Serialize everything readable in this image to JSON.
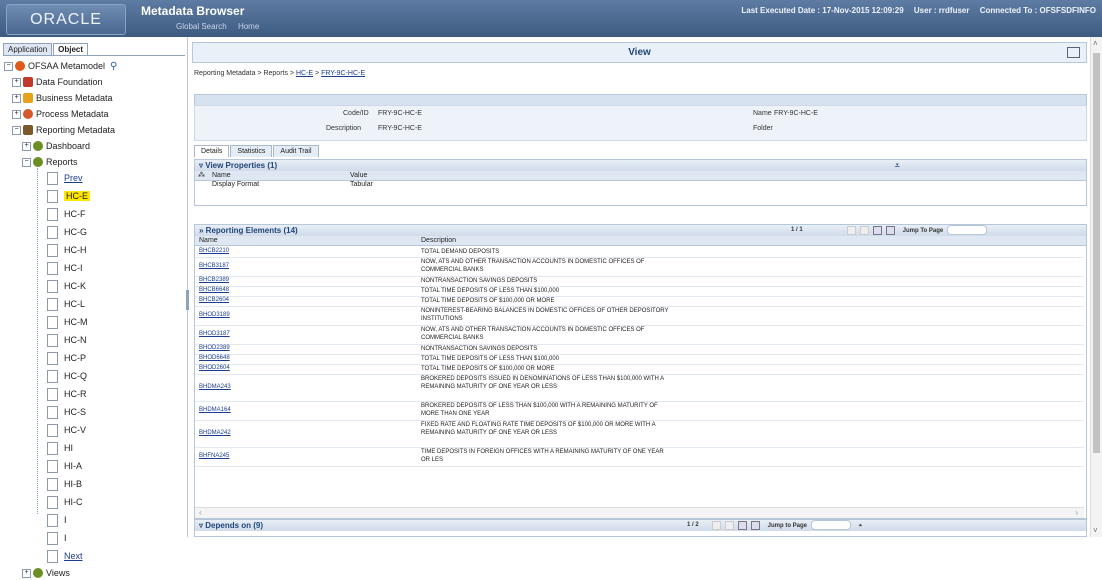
{
  "header": {
    "logo": "ORACLE",
    "title": "Metadata Browser",
    "nav": [
      "Global Search",
      "Home"
    ],
    "last_executed": "Last Executed Date : 17-Nov-2015 12:09:29",
    "user": "User : rrdfuser",
    "connected": "Connected To : OFSFSDFINFO"
  },
  "left": {
    "tabs": [
      "Application",
      "Object"
    ],
    "root": "OFSAA Metamodel",
    "groups": [
      "Data Foundation",
      "Business Metadata",
      "Process Metadata",
      "Reporting Metadata"
    ],
    "reporting_children": [
      "Dashboard",
      "Reports"
    ],
    "reports": [
      "Prev",
      "HC-E",
      "HC-F",
      "HC-G",
      "HC-H",
      "HC-I",
      "HC-K",
      "HC-L",
      "HC-M",
      "HC-N",
      "HC-P",
      "HC-Q",
      "HC-R",
      "HC-S",
      "HC-V",
      "HI",
      "HI-A",
      "HI-B",
      "HI-C",
      "I",
      "I",
      "Next"
    ],
    "views": "Views"
  },
  "main": {
    "view_title": "View",
    "breadcrumb": {
      "prefix": "Reporting Metadata > Reports > ",
      "link1": "HC-E",
      "sep": " > ",
      "link2": "FRY-9C-HC-E"
    },
    "code_label": "Code/ID",
    "code_value": "FRY-9C-HC-E",
    "desc_label": "Description",
    "desc_value": "FRY-9C-HC-E",
    "name_label": "Name",
    "name_value": "FRY-9C-HC-E",
    "folder_label": "Folder",
    "tabs": [
      "Details",
      "Statistics",
      "Audit Trail"
    ],
    "view_props": {
      "title": "View Properties (1)",
      "col_name": "Name",
      "col_value": "Value",
      "row_name": "Display Format",
      "row_value": "Tabular"
    },
    "reporting": {
      "title": "Reporting Elements (14)",
      "page": "1 / 1",
      "jump": "Jump To Page",
      "col_name": "Name",
      "col_desc": "Description",
      "rows": [
        {
          "name": "BHCB2210",
          "desc": "TOTAL DEMAND DEPOSITS"
        },
        {
          "name": "BHCB3187",
          "desc": "NOW, ATS AND OTHER TRANSACTION ACCOUNTS IN DOMESTIC OFFICES OF COMMERCIAL BANKS"
        },
        {
          "name": "BHCB2389",
          "desc": "NONTRANSACTION SAVINGS DEPOSITS"
        },
        {
          "name": "BHCB6648",
          "desc": "TOTAL TIME DEPOSITS OF LESS THAN $100,000"
        },
        {
          "name": "BHCB2604",
          "desc": "TOTAL TIME DEPOSITS OF $100,000 OR MORE"
        },
        {
          "name": "BHOD3189",
          "desc": "NONINTEREST-BEARING BALANCES IN DOMESTIC OFFICES OF OTHER DEPOSITORY INSTITUTIONS"
        },
        {
          "name": "BHOD3187",
          "desc": "NOW, ATS AND OTHER TRANSACTION ACCOUNTS IN DOMESTIC OFFICES OF COMMERCIAL BANKS"
        },
        {
          "name": "BHOD2389",
          "desc": "NONTRANSACTION SAVINGS DEPOSITS"
        },
        {
          "name": "BHOD6648",
          "desc": "TOTAL TIME DEPOSITS OF LESS THAN $100,000"
        },
        {
          "name": "BHOD2604",
          "desc": "TOTAL TIME DEPOSITS OF $100,000 OR MORE"
        },
        {
          "name": "BHDMA243",
          "desc": "BROKERED DEPOSITS ISSUED IN DENOMINATIONS OF LESS THAN $100,000 WITH A REMAINING MATURITY OF ONE YEAR OR LESS"
        },
        {
          "name": "BHDMA164",
          "desc": "BROKERED DEPOSITS OF LESS THAN $100,000 WITH A REMAINING MATURITY OF MORE THAN ONE YEAR"
        },
        {
          "name": "BHDMA242",
          "desc": "FIXED RATE AND FLOATING RATE TIME DEPOSITS OF $100,000 OR MORE WITH A REMAINING MATURITY OF ONE YEAR OR LESS"
        },
        {
          "name": "BHFNA245",
          "desc": "TIME DEPOSITS IN FOREIGN OFFICES WITH A REMAINING MATURITY OF ONE YEAR OR LES"
        }
      ]
    },
    "depends": {
      "title": "Depends on (9)",
      "page": "1 / 2",
      "jump": "Jump to Page"
    }
  }
}
